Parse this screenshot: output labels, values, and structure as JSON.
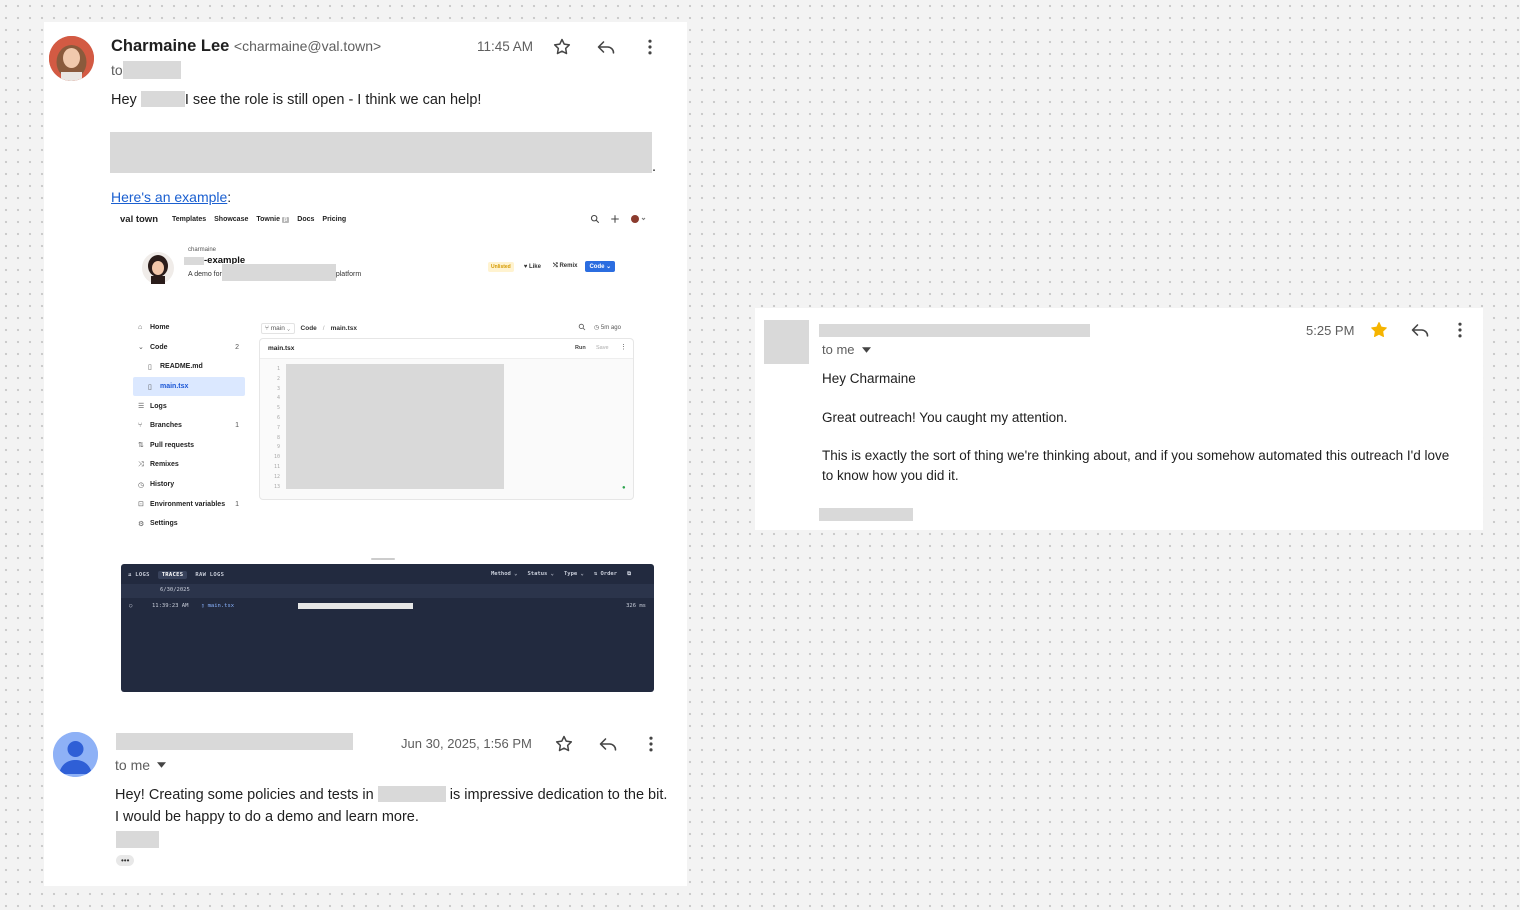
{
  "email1": {
    "sender_name": "Charmaine Lee",
    "sender_email": "<charmaine@val.town>",
    "to_label": "to",
    "time": "11:45 AM",
    "greeting_prefix": "Hey",
    "greeting_suffix": "I see the role is still open - I think we can help!",
    "trailing_period": ".",
    "example_link": "Here's an example",
    "example_colon": ":"
  },
  "valtown": {
    "logo": "val town",
    "nav": [
      "Templates",
      "Showcase",
      "Townie",
      "Docs",
      "Pricing"
    ],
    "townie_badge": "β",
    "owner": "charmaine",
    "project_suffix": "-example",
    "desc_prefix": "A demo for",
    "desc_suffix": "platform",
    "status_badge": "Unlisted",
    "like_label": "Like",
    "remix_label": "Remix",
    "code_label": "Code",
    "branch": "main",
    "crumb_code": "Code",
    "crumb_file": "main.tsx",
    "updated": "5m ago",
    "editor_file": "main.tsx",
    "run_label": "Run",
    "save_label": "Save",
    "sidebar": [
      {
        "label": "Home",
        "icon": "home-icon",
        "count": ""
      },
      {
        "label": "Code",
        "icon": "chevron-down-icon",
        "count": "2"
      },
      {
        "label": "README.md",
        "icon": "file-icon",
        "count": ""
      },
      {
        "label": "main.tsx",
        "icon": "file-icon",
        "count": ""
      },
      {
        "label": "Logs",
        "icon": "list-icon",
        "count": ""
      },
      {
        "label": "Branches",
        "icon": "branch-icon",
        "count": "1"
      },
      {
        "label": "Pull requests",
        "icon": "pull-request-icon",
        "count": ""
      },
      {
        "label": "Remixes",
        "icon": "shuffle-icon",
        "count": ""
      },
      {
        "label": "History",
        "icon": "history-icon",
        "count": ""
      },
      {
        "label": "Environment variables",
        "icon": "lock-icon",
        "count": "1"
      },
      {
        "label": "Settings",
        "icon": "gear-icon",
        "count": ""
      }
    ],
    "line_numbers": [
      "1",
      "2",
      "3",
      "4",
      "5",
      "6",
      "7",
      "8",
      "9",
      "10",
      "11",
      "12",
      "13"
    ],
    "logs": {
      "tab_logs": "LOGS",
      "tab_traces": "TRACES",
      "tab_raw": "RAW LOGS",
      "filter_method": "Method",
      "filter_status": "Status",
      "filter_type": "Type",
      "filter_order": "Order",
      "date": "6/30/2025",
      "row_time": "11:39:23 AM",
      "row_file": "main.tsx",
      "row_duration": "326 ms"
    }
  },
  "email2": {
    "time": "Jun 30, 2025, 1:56 PM",
    "to_label": "to me",
    "line1_prefix": "Hey! Creating some policies and tests in",
    "line1_suffix": "is impressive dedication to the bit.",
    "line2": "I would be happy to do a demo and learn more.",
    "more": "•••"
  },
  "email3": {
    "time": "5:25 PM",
    "to_label": "to me",
    "greeting": "Hey Charmaine",
    "para1": "Great outreach! You caught my attention.",
    "para2": "This is exactly the sort of thing we're thinking about, and if you somehow automated this outreach I'd love to know how you did it."
  },
  "colors": {
    "star_filled": "#f5b400",
    "link": "#1a5fd0",
    "redaction": "#d9d9d9"
  }
}
